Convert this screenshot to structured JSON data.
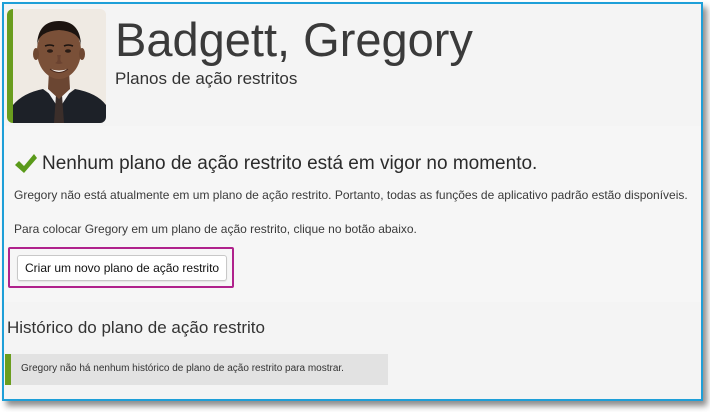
{
  "profile": {
    "name": "Badgett, Gregory",
    "subtitle": "Planos de ação restritos",
    "avatar_icon": "person-photo"
  },
  "status": {
    "icon": "checkmark-icon",
    "heading": "Nenhum plano de ação restrito está em vigor no momento.",
    "info_line_1": "Gregory não está atualmente em um plano de ação restrito. Portanto, todas as funções de aplicativo padrão estão disponíveis.",
    "info_line_2": "Para colocar Gregory em um plano de ação restrito, clique no botão abaixo.",
    "create_button_label": "Criar um novo plano de ação restrito"
  },
  "history": {
    "title": "Histórico do plano de ação restrito",
    "empty_message": "Gregory não há nenhum histórico de plano de ação restrito para mostrar."
  },
  "colors": {
    "accent_green": "#6a9d1e",
    "frame_blue": "#1e9fd8",
    "highlight_magenta": "#b0228c",
    "check_green": "#5a9a1a"
  }
}
